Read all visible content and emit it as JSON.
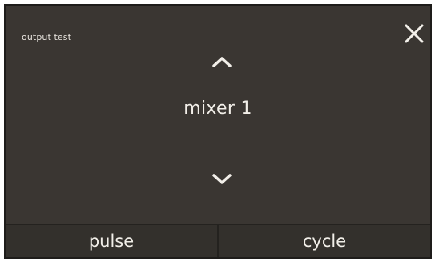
{
  "screen": {
    "title": "output test"
  },
  "selector": {
    "current_item": "mixer 1"
  },
  "icons": {
    "close": "close-icon",
    "up": "chevron-up-icon",
    "down": "chevron-down-icon"
  },
  "buttons": {
    "pulse_label": "pulse",
    "cycle_label": "cycle"
  },
  "colors": {
    "background": "#3a3632",
    "text": "#f2efe9",
    "bar": "#33302c"
  }
}
